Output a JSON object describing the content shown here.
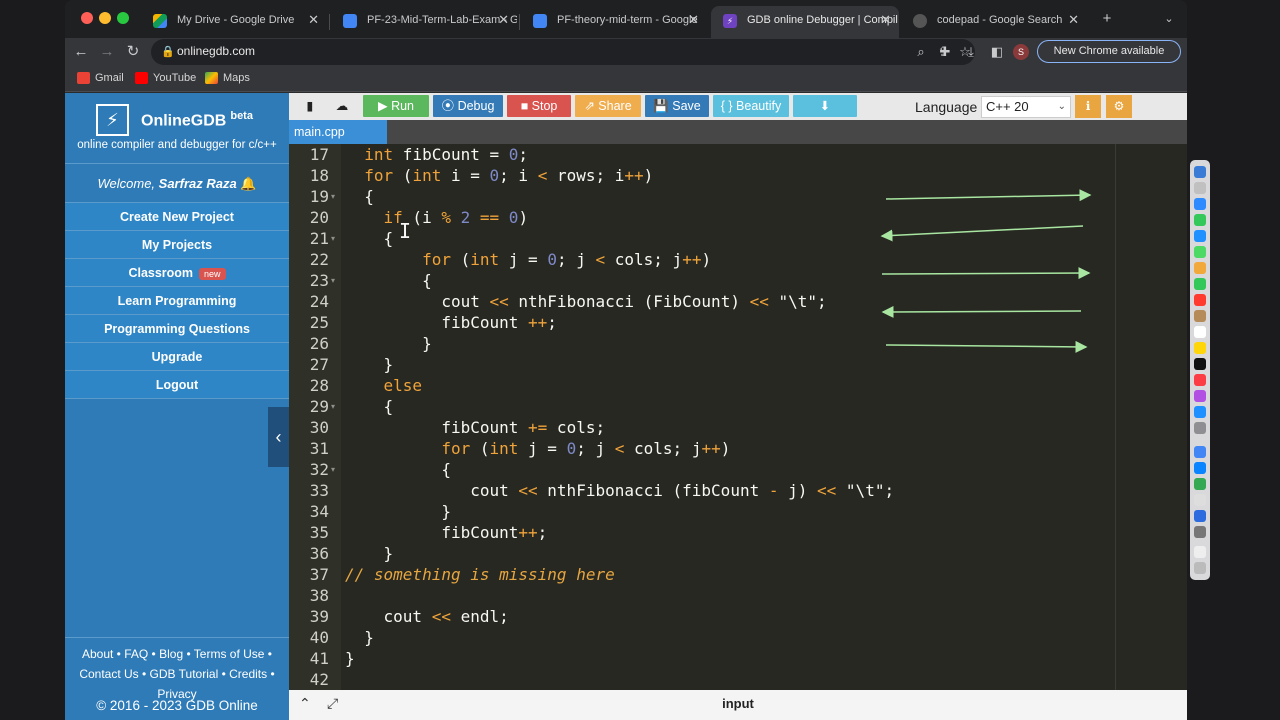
{
  "browser": {
    "tabs": [
      {
        "title": "My Drive - Google Drive",
        "icon": "google-drive-icon"
      },
      {
        "title": "PF-23-Mid-Term-Lab-Exam - G",
        "icon": "google-docs-icon"
      },
      {
        "title": "PF-theory-mid-term - Google",
        "icon": "google-docs-icon"
      },
      {
        "title": "GDB online Debugger | Compil",
        "icon": "onlinegdb-icon"
      },
      {
        "title": "codepad - Google Search",
        "icon": "google-icon"
      }
    ],
    "new_tab": "+",
    "url": "onlinegdb.com",
    "update_label": "New Chrome available",
    "profile_initial": "S",
    "bookmarks": [
      {
        "label": "Gmail",
        "icon": "gmail-icon"
      },
      {
        "label": "YouTube",
        "icon": "youtube-icon"
      },
      {
        "label": "Maps",
        "icon": "maps-icon"
      }
    ]
  },
  "sidebar": {
    "brand": "OnlineGDB",
    "brand_badge": "beta",
    "tagline": "online compiler and debugger for c/c++",
    "welcome_prefix": "Welcome, ",
    "user_name": "Sarfraz Raza",
    "menu": [
      {
        "label": "Create New Project"
      },
      {
        "label": "My Projects"
      },
      {
        "label": "Classroom",
        "badge": "new"
      },
      {
        "label": "Learn Programming"
      },
      {
        "label": "Programming Questions"
      },
      {
        "label": "Upgrade"
      },
      {
        "label": "Logout"
      }
    ],
    "footer_links": [
      "About",
      "FAQ",
      "Blog",
      "Terms of Use",
      "Contact Us",
      "GDB Tutorial",
      "Credits",
      "Privacy"
    ],
    "copyright": "© 2016 - 2023 GDB Online"
  },
  "ide": {
    "buttons": {
      "run": "Run",
      "debug": "Debug",
      "stop": "Stop",
      "share": "Share",
      "save": "Save",
      "beautify": "{ } Beautify"
    },
    "language_label": "Language",
    "language_value": "C++ 20",
    "file_tab": "main.cpp",
    "bottom_label": "input",
    "colors": {
      "run": "#5cb85c",
      "debug": "#337ab7",
      "stop": "#d9534f",
      "share": "#f0ad4e",
      "save": "#337ab7",
      "beautify": "#5bc0de",
      "download": "#5bc0de"
    }
  },
  "code": {
    "lines": [
      {
        "n": "17",
        "fold": false
      },
      {
        "n": "18",
        "fold": false
      },
      {
        "n": "19",
        "fold": true
      },
      {
        "n": "20",
        "fold": false
      },
      {
        "n": "21",
        "fold": true
      },
      {
        "n": "22",
        "fold": false
      },
      {
        "n": "23",
        "fold": true
      },
      {
        "n": "24",
        "fold": false
      },
      {
        "n": "25",
        "fold": false
      },
      {
        "n": "26",
        "fold": false
      },
      {
        "n": "27",
        "fold": false
      },
      {
        "n": "28",
        "fold": false
      },
      {
        "n": "29",
        "fold": true
      },
      {
        "n": "30",
        "fold": false
      },
      {
        "n": "31",
        "fold": false
      },
      {
        "n": "32",
        "fold": true
      },
      {
        "n": "33",
        "fold": false
      },
      {
        "n": "34",
        "fold": false
      },
      {
        "n": "35",
        "fold": false
      },
      {
        "n": "36",
        "fold": false
      },
      {
        "n": "37",
        "fold": false
      },
      {
        "n": "38",
        "fold": false
      },
      {
        "n": "39",
        "fold": false
      },
      {
        "n": "40",
        "fold": false
      },
      {
        "n": "41",
        "fold": false
      },
      {
        "n": "42",
        "fold": false
      }
    ],
    "source": [
      "  int fibCount = 0;",
      "  for (int i = 0; i < rows; i++)",
      "  {",
      "    if (i % 2 == 0)",
      "    {",
      "        for (int j = 0; j < cols; j++)",
      "        {",
      "          cout << nthFibonacci (FibCount) << \"\\t\";",
      "          fibCount ++;",
      "        }",
      "    }",
      "    else",
      "    {",
      "          fibCount += cols;",
      "          for (int j = 0; j < cols; j++)",
      "          {",
      "             cout << nthFibonacci (fibCount - j) << \"\\t\";",
      "          }",
      "          fibCount++;",
      "    }",
      "// something is missing here",
      "",
      "    cout << endl;",
      "  }",
      "}",
      ""
    ]
  }
}
